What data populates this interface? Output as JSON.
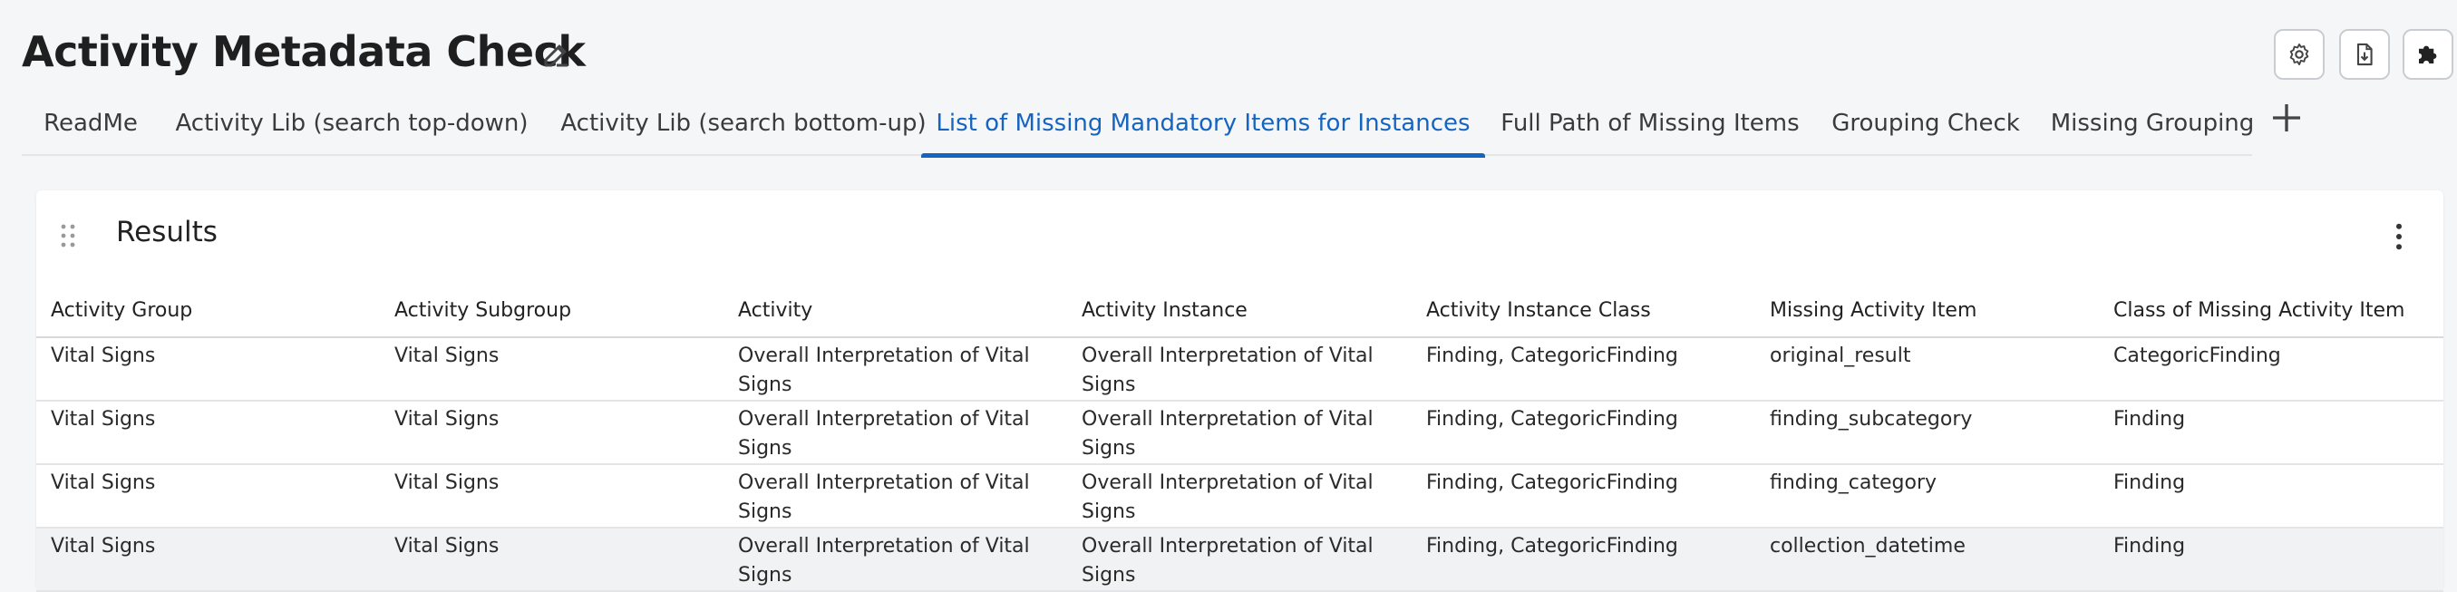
{
  "header": {
    "title": "Activity Metadata Check",
    "edit_icon": "pencil-icon",
    "tools": [
      "settings-icon",
      "export-icon",
      "extensions-icon"
    ]
  },
  "tabs": [
    {
      "label": "ReadMe",
      "active": false
    },
    {
      "label": "Activity Lib (search top-down)",
      "active": false
    },
    {
      "label": "Activity Lib (search bottom-up)",
      "active": false
    },
    {
      "label": "List of Missing Mandatory Items for Instances",
      "active": true
    },
    {
      "label": "Full Path of Missing Items",
      "active": false
    },
    {
      "label": "Grouping Check",
      "active": false
    },
    {
      "label": "Missing Grouping",
      "active": false
    }
  ],
  "colors": {
    "accent": "#1565c0",
    "background": "#f5f6f8"
  },
  "results": {
    "title": "Results",
    "columns": [
      "Activity Group",
      "Activity Subgroup",
      "Activity",
      "Activity Instance",
      "Activity Instance Class",
      "Missing Activity Item",
      "Class of Missing Activity Item"
    ],
    "rows": [
      [
        "Vital Signs",
        "Vital Signs",
        "Overall Interpretation of Vital Signs",
        "Overall Interpretation of Vital Signs",
        "Finding, CategoricFinding",
        "original_result",
        "CategoricFinding"
      ],
      [
        "Vital Signs",
        "Vital Signs",
        "Overall Interpretation of Vital Signs",
        "Overall Interpretation of Vital Signs",
        "Finding, CategoricFinding",
        "finding_subcategory",
        "Finding"
      ],
      [
        "Vital Signs",
        "Vital Signs",
        "Overall Interpretation of Vital Signs",
        "Overall Interpretation of Vital Signs",
        "Finding, CategoricFinding",
        "finding_category",
        "Finding"
      ],
      [
        "Vital Signs",
        "Vital Signs",
        "Overall Interpretation of Vital Signs",
        "Overall Interpretation of Vital Signs",
        "Finding, CategoricFinding",
        "collection_datetime",
        "Finding"
      ]
    ]
  }
}
